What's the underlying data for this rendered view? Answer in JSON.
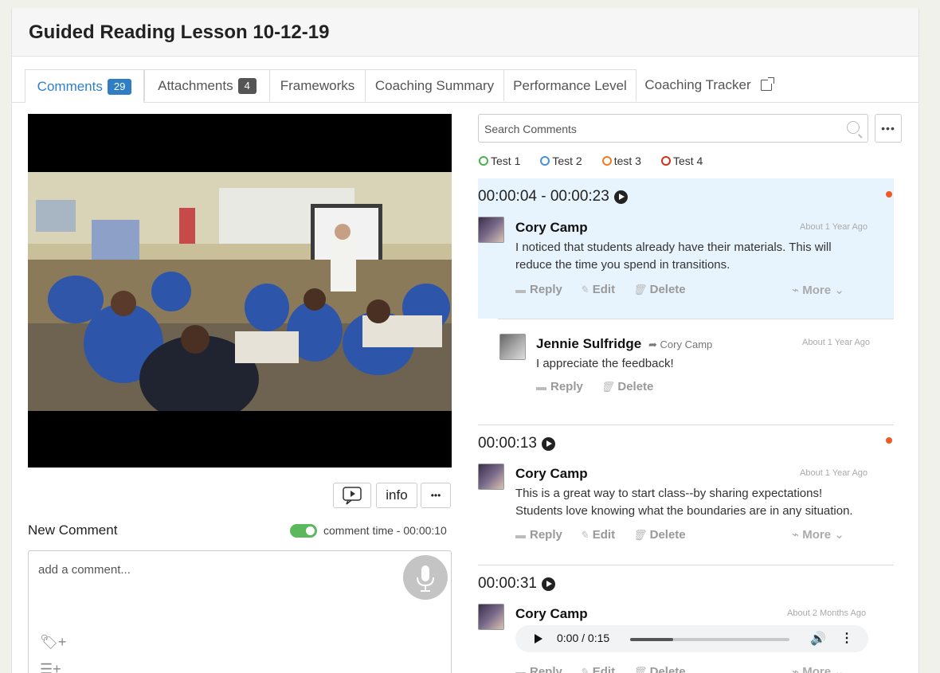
{
  "header": {
    "title": "Guided Reading Lesson 10-12-19"
  },
  "tabs": [
    {
      "label": "Comments",
      "badge": "29"
    },
    {
      "label": "Attachments",
      "badge": "4"
    },
    {
      "label": "Frameworks"
    },
    {
      "label": "Coaching Summary"
    },
    {
      "label": "Performance Level"
    },
    {
      "label": "Coaching Tracker"
    }
  ],
  "player": {
    "info_label": "info",
    "more_label": "•••"
  },
  "new_comment": {
    "heading": "New Comment",
    "comment_time": "comment time - 00:00:10",
    "placeholder": "add a comment..."
  },
  "search": {
    "placeholder": "Search Comments",
    "more_label": "•••"
  },
  "legend": [
    {
      "label": "Test 1",
      "color": "#4caf50"
    },
    {
      "label": "Test 2",
      "color": "#4a90d9"
    },
    {
      "label": "test 3",
      "color": "#ef7d22"
    },
    {
      "label": "Test 4",
      "color": "#d0321c"
    }
  ],
  "actions": {
    "reply": "Reply",
    "edit": "Edit",
    "delete": "Delete",
    "more": "More"
  },
  "comments": [
    {
      "timestamp": "00:00:04 - 00:00:23",
      "author": "Cory Camp",
      "ago": "About 1 Year Ago",
      "text": "I noticed that students already have their materials. This will reduce the time you spend in transitions.",
      "reply": {
        "author": "Jennie Sulfridge",
        "to": "Cory Camp",
        "ago": "About 1 Year Ago",
        "text": "I appreciate the feedback!"
      }
    },
    {
      "timestamp": "00:00:13",
      "author": "Cory Camp",
      "ago": "About 1 Year Ago",
      "text": "This is a great way to start class--by sharing expectations! Students love knowing what the boundaries are in any situation."
    },
    {
      "timestamp": "00:00:31",
      "author": "Cory Camp",
      "ago": "About 2 Months Ago",
      "audio_time": "0:00 / 0:15",
      "audio_progress": 0.27
    }
  ]
}
